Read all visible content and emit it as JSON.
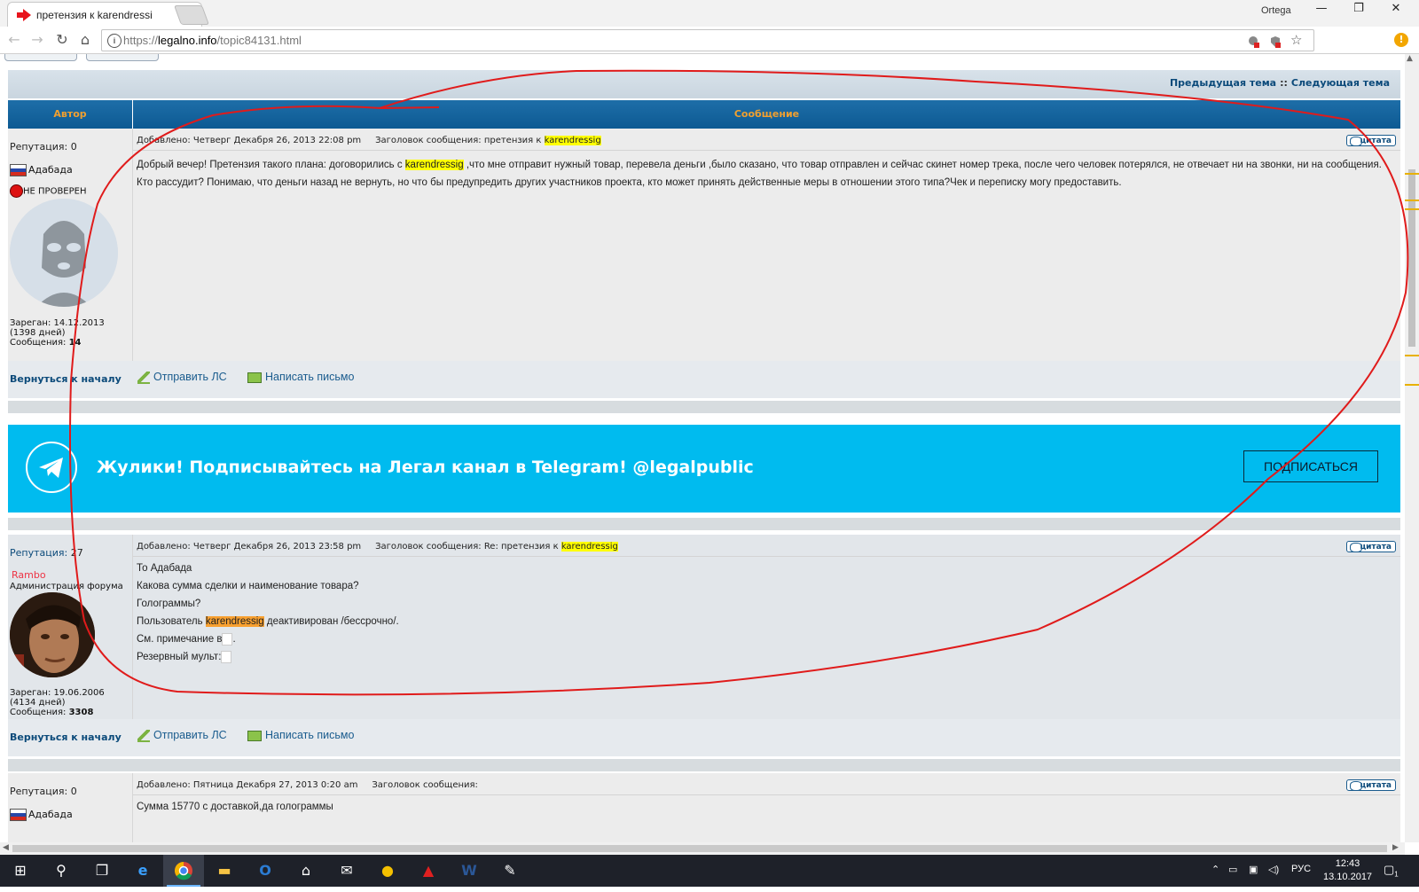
{
  "browser": {
    "tab_title": "претензия к karendressi",
    "user": "Ortega",
    "url_scheme": "https://",
    "url_host": "legalno.info",
    "url_path": "/topic84131.html"
  },
  "forum": {
    "prev_topic": "Предыдущая тема",
    "sep": "::",
    "next_topic": "Следующая тема",
    "col_author": "Автор",
    "col_message": "Сообщение",
    "quote_label": "цитата",
    "back_to_top": "Вернуться к началу",
    "send_pm": "Отправить ЛС",
    "write_mail": "Написать письмо"
  },
  "posts": [
    {
      "reputation_label": "Репутация:",
      "reputation": "0",
      "author": "Адабада",
      "status": "НЕ ПРОВЕРЕН",
      "registered": "Зареган: 14.12.2013 (1398 дней)",
      "messages_label": "Сообщения:",
      "messages": "14",
      "added": "Добавлено: Четверг Декабря 26, 2013 22:08 pm",
      "subject_label": "Заголовок сообщения:",
      "subject_prefix": "претензия к",
      "subject_kw": "karendressig",
      "text_1a": "Добрый вечер! Претензия такого плана: договорились с",
      "text_1kw": "karendressig",
      "text_1b": ",что мне отправит нужный товар, перевела деньги ,было сказано, что товар отправлен и сейчас скинет номер трека, после чего человек потерялся, не отвечает ни на звонки, ни на сообщения.",
      "text_2": "Кто рассудит? Понимаю, что деньги назад не вернуть, но что бы предупредить других участников проекта, кто может принять действенные меры в отношении этого типа?Чек и переписку могу предоставить."
    },
    {
      "reputation_label": "Репутация:",
      "reputation": "27",
      "author": "Rambo",
      "status": "Администрация форума",
      "registered": "Зареган: 19.06.2006 (4134 дней)",
      "messages_label": "Сообщения:",
      "messages": "3308",
      "added": "Добавлено: Четверг Декабря 26, 2013 23:58 pm",
      "subject_label": "Заголовок сообщения:",
      "subject_prefix": "Re: претензия к",
      "subject_kw": "karendressig",
      "line_1": "То Адабада",
      "line_2": "Какова сумма сделки и наименование товара?",
      "line_3": "Голограммы?",
      "line_4a": "Пользователь",
      "line_4kw": "karendressig",
      "line_4b": "деактивирован /бессрочно/.",
      "line_5": "См. примечание в",
      "line_5end": ".",
      "line_6": "Резервный мульт:"
    },
    {
      "reputation_label": "Репутация:",
      "reputation": "0",
      "author": "Адабада",
      "added": "Добавлено: Пятница Декабря 27, 2013 0:20 am",
      "subject_label": "Заголовок сообщения:",
      "text": "Сумма 15770 с доставкой,да голограммы"
    }
  ],
  "banner": {
    "text": "Жулики! Подписывайтесь на Легал канал в Telegram! @legalpublic",
    "button": "ПОДПИСАТЬСЯ",
    "color": "#00bbef"
  },
  "taskbar": {
    "lang": "РУС",
    "time": "12:43",
    "date": "13.10.2017",
    "notifications": "1"
  }
}
